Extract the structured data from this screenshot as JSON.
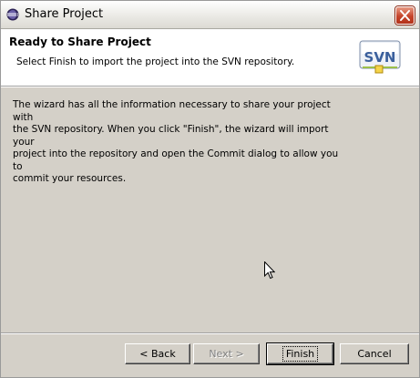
{
  "window": {
    "title": "Share Project",
    "icons": {
      "app": "eclipse-icon",
      "close": "close-icon"
    }
  },
  "banner": {
    "title": "Ready to Share Project",
    "description": "Select Finish to import the project into the SVN repository.",
    "logo_text": "SVN"
  },
  "content": {
    "lines": [
      "The wizard has all the information necessary to share your project with",
      "the SVN repository. When you click \"Finish\", the wizard will import your",
      "project into the repository and open the Commit dialog to allow you to",
      "commit your resources."
    ]
  },
  "buttons": {
    "back": "< Back",
    "next": "Next >",
    "finish": "Finish",
    "cancel": "Cancel"
  },
  "colors": {
    "dialog_bg": "#d4d0c8",
    "banner_bg": "#ffffff",
    "close_red": "#c5442a"
  }
}
